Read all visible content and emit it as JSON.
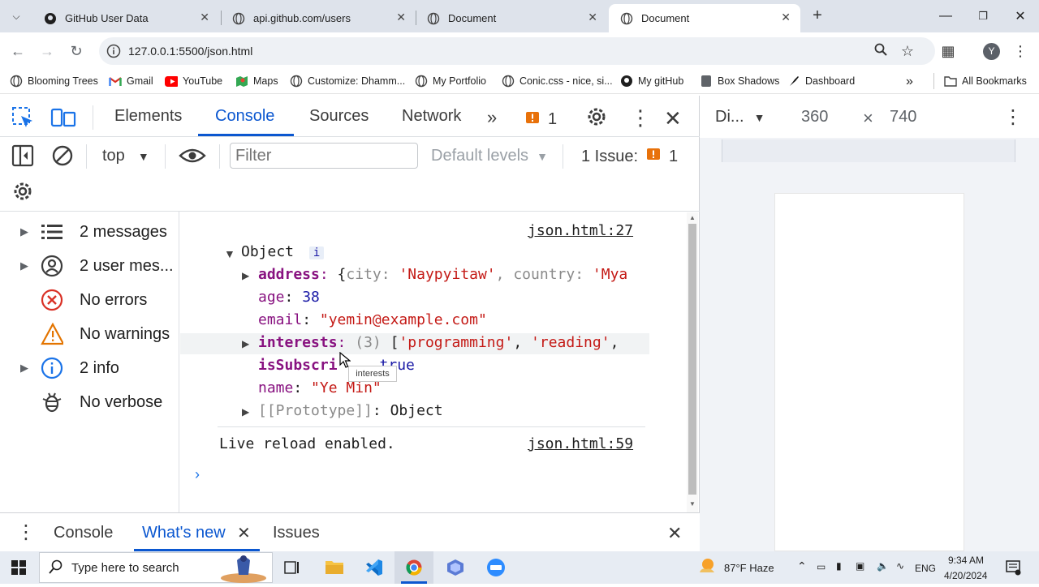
{
  "browser": {
    "tabs": [
      {
        "title": "GitHub User Data",
        "icon": "github-icon",
        "active": false
      },
      {
        "title": "api.github.com/users",
        "icon": "globe-icon",
        "active": false
      },
      {
        "title": "Document",
        "icon": "globe-icon",
        "active": false
      },
      {
        "title": "Document",
        "icon": "globe-icon",
        "active": true
      }
    ],
    "url": "127.0.0.1:5500/json.html",
    "bookmarks": [
      {
        "label": "Blooming Trees",
        "icon": "globe-icon"
      },
      {
        "label": "Gmail",
        "icon": "gmail-icon"
      },
      {
        "label": "YouTube",
        "icon": "youtube-icon"
      },
      {
        "label": "Maps",
        "icon": "maps-icon"
      },
      {
        "label": "Customize: Dhamm...",
        "icon": "globe-icon"
      },
      {
        "label": "My Portfolio",
        "icon": "globe-icon"
      },
      {
        "label": "Conic.css - nice, si...",
        "icon": "globe-icon"
      },
      {
        "label": "My gitHub",
        "icon": "github-icon"
      },
      {
        "label": "Box Shadows",
        "icon": "bookmark-icon"
      },
      {
        "label": "Dashboard",
        "icon": "bookmark-icon"
      }
    ],
    "all_bookmarks": "All Bookmarks",
    "profile_initial": "Y"
  },
  "devtools": {
    "tabs": [
      "Elements",
      "Console",
      "Sources",
      "Network"
    ],
    "issue_count_tab": "1",
    "context": "top",
    "filter_placeholder": "Filter",
    "levels": "Default levels",
    "issues_label": "1 Issue:",
    "issues_count": "1",
    "sidebar": [
      {
        "label": "2 messages",
        "icon": "list-icon",
        "expandable": true
      },
      {
        "label": "2 user mes...",
        "icon": "user-icon",
        "expandable": true
      },
      {
        "label": "No errors",
        "icon": "error-icon",
        "expandable": false
      },
      {
        "label": "No warnings",
        "icon": "warning-icon",
        "expandable": false
      },
      {
        "label": "2 info",
        "icon": "info-icon",
        "expandable": true
      },
      {
        "label": "No verbose",
        "icon": "bug-icon",
        "expandable": false
      }
    ],
    "console": {
      "link1": "json.html:27",
      "object_label": "Object",
      "info_badge": "i",
      "address_key": "address",
      "address_value_prefix": "{",
      "address_city_key": "city",
      "address_city_val": "'Naypyitaw'",
      "address_country_key": "country",
      "address_country_val": "'Mya",
      "age_key": "age",
      "age_val": "38",
      "email_key": "email",
      "email_val": "\"yemin@example.com\"",
      "interests_key": "interests",
      "interests_count": "(3)",
      "interests_prefix": "[",
      "interests_v1": "'programming'",
      "interests_v2": "'reading'",
      "subscribed_key": "isSubscri",
      "subscribed_val": "true",
      "name_key": "name",
      "name_val": "\"Ye Min\"",
      "proto_key": "[[Prototype]]",
      "proto_val": "Object",
      "tooltip": "interests",
      "log2": "Live reload enabled.",
      "link2": "json.html:59"
    },
    "drawer_tabs": [
      "Console",
      "What's new",
      "Issues"
    ]
  },
  "device": {
    "name": "Di...",
    "width": "360",
    "times": "×",
    "height": "740"
  },
  "taskbar": {
    "search_placeholder": "Type here to search",
    "weather": "87°F  Haze",
    "lang": "ENG",
    "time": "9:34 AM",
    "date": "4/20/2024"
  },
  "colors": {
    "accent": "#0b57d0",
    "key_purple": "#881280",
    "string_red": "#c41a16",
    "number_blue": "#1a1aa6",
    "error_red": "#d93025",
    "warning_orange": "#e37400",
    "info_blue": "#1a73e8"
  }
}
